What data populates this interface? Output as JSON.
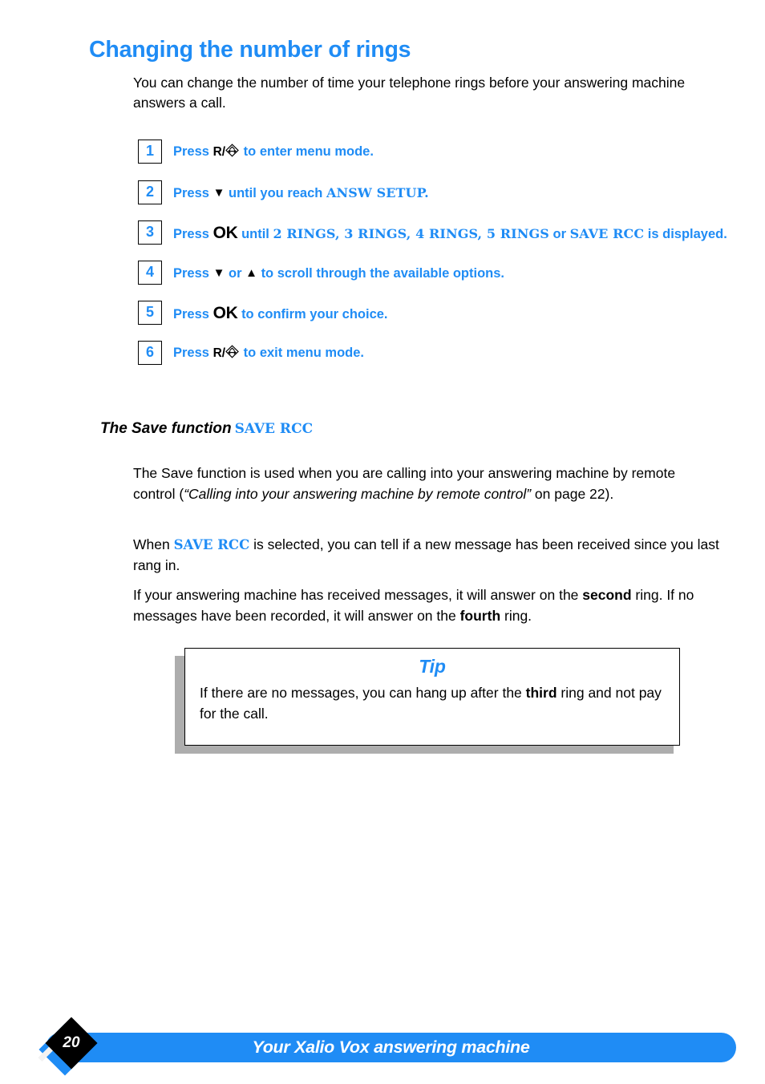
{
  "document": {
    "heading": "Changing the number of rings",
    "intro": "You can change the number of time your telephone rings before your answering machine answers a call."
  },
  "steps": [
    {
      "number": "1",
      "press_label": "Press",
      "key": "R/",
      "key_icon": "recall-diamond-icon",
      "text": "to enter menu mode."
    },
    {
      "number": "2",
      "press_label": "Press",
      "key": "down-triangle-icon",
      "text": "until you reach",
      "lcd": "ANSW SETUP.",
      "text_after": ""
    },
    {
      "number": "3",
      "press_label": "Press",
      "key": "OK",
      "text": "until",
      "lcd": "2 RINGS, 3 RINGS, 4 RINGS, 5 RINGS",
      "conjunction": "or",
      "lcd2": "SAVE RCC",
      "text_after": "is displayed."
    },
    {
      "number": "4",
      "press_label": "Press",
      "key": "down-triangle-icon",
      "conjunction": "or",
      "key2": "up-triangle-icon",
      "text": "to scroll through the available options."
    },
    {
      "number": "5",
      "press_label": "Press",
      "key": "OK",
      "text": "to confirm your choice."
    },
    {
      "number": "6",
      "press_label": "Press",
      "key": "R/",
      "key_icon": "recall-diamond-icon",
      "text": "to exit menu mode."
    }
  ],
  "save_section": {
    "heading": "The Save function",
    "heading_lcd": "SAVE RCC",
    "para1_a": "The Save function is used when you are calling into your answering machine by remote control (",
    "para1_italic": "“Calling into your answering machine by remote control”",
    "para1_b": " on page 22).",
    "para2_a": "When ",
    "para2_lcd": "SAVE RCC",
    "para2_b": " is selected, you can tell if a new message has been received since you last rang in.",
    "para3_a": "If your answering machine has received messages, it will answer on the ",
    "para3_bold1": "second",
    "para3_b": " ring.  If no messages have been recorded, it will answer on the ",
    "para3_bold2": "fourth",
    "para3_c": " ring."
  },
  "tip": {
    "title": "Tip",
    "text_a": "If there are no messages, you can hang up after the ",
    "text_bold": "third",
    "text_b": " ring and not pay for the call."
  },
  "footer": {
    "page_number": "20",
    "title": "Your Xalio Vox answering machine"
  },
  "colors": {
    "accent_blue": "#1f8cf5",
    "shadow_gray": "#adadad",
    "black": "#000000",
    "white": "#ffffff"
  }
}
